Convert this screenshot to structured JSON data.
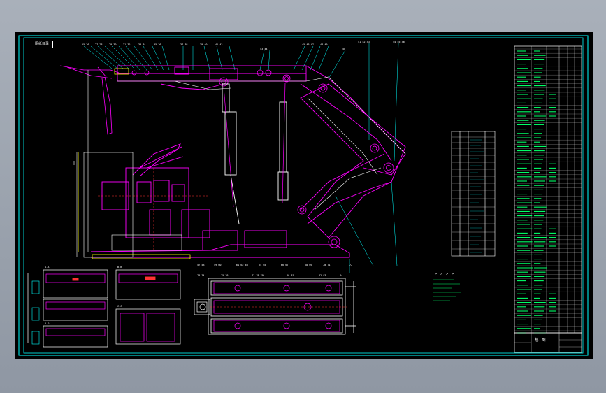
{
  "drawing": {
    "corner_tag": "图纸目录",
    "title_block_label": "总 图",
    "note_marker": "> > > >",
    "colors": {
      "background": "#000000",
      "frame": "#00ffff",
      "part": "#ff00ff",
      "outline": "#ffffff",
      "table_text": "#00ff66",
      "highlight": "#ffff00",
      "section": "#ff3333"
    }
  }
}
